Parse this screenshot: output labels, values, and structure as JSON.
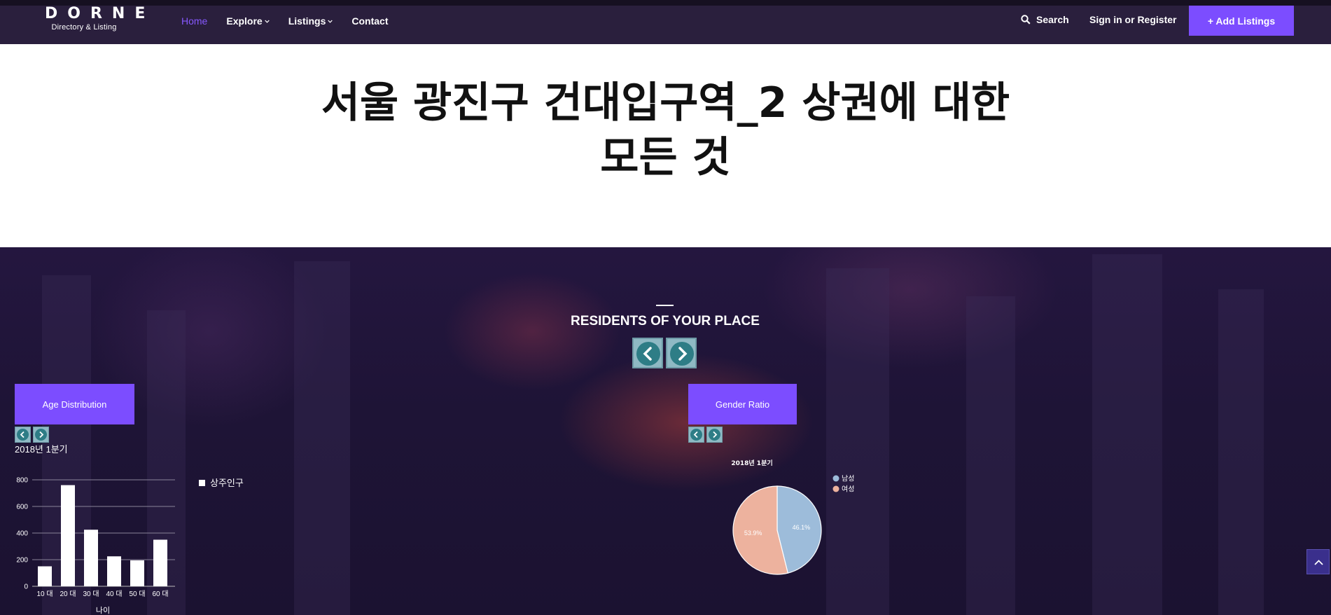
{
  "header": {
    "logo_title": "DORNE",
    "logo_subtitle": "Directory & Listing",
    "nav": [
      {
        "label": "Home",
        "dropdown": false,
        "active": true
      },
      {
        "label": "Explore",
        "dropdown": true,
        "active": false
      },
      {
        "label": "Listings",
        "dropdown": true,
        "active": false
      },
      {
        "label": "Contact",
        "dropdown": false,
        "active": false
      }
    ],
    "search_label": "Search",
    "signin_label": "Sign in or Register",
    "add_listing_label": "+ Add Listings"
  },
  "hero": {
    "title": "서울 광진구 건대입구역_2 상권에 대한 모든 것"
  },
  "section": {
    "title": "RESIDENTS OF YOUR PLACE"
  },
  "age_panel": {
    "tab_label": "Age Distribution",
    "quarter_label": "2018년 1분기"
  },
  "gender_panel": {
    "tab_label": "Gender Ratio",
    "quarter_label": "2018년 1분기"
  },
  "colors": {
    "accent": "#7c4dff",
    "header_bg": "#2a1f3d",
    "male": "#9dbcda",
    "female": "#edb29e"
  },
  "chart_data": [
    {
      "type": "bar",
      "categories": [
        "10 대",
        "20 대",
        "30 대",
        "40 대",
        "50 대",
        "60 대"
      ],
      "series": [
        {
          "name": "상주인구",
          "values": [
            150,
            760,
            425,
            225,
            195,
            350
          ]
        }
      ],
      "xlabel": "나이",
      "ylabel": "",
      "ylim": [
        0,
        800
      ],
      "yticks": [
        0,
        200,
        400,
        600,
        800
      ],
      "grid": true,
      "legend": "right"
    },
    {
      "type": "pie",
      "title": "2018년 1분기",
      "labels": [
        "남성",
        "여성"
      ],
      "values": [
        46.1,
        53.9
      ],
      "value_labels": [
        "46.1%",
        "53.9%"
      ],
      "legend": "top-right"
    }
  ]
}
